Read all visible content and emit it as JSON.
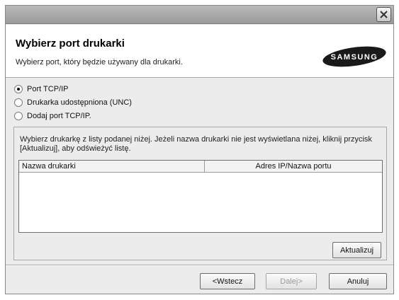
{
  "window": {
    "close_icon": "close-icon"
  },
  "header": {
    "title": "Wybierz port drukarki",
    "subtitle": "Wybierz port, który będzie używany dla drukarki.",
    "logo_text": "SAMSUNG"
  },
  "options": [
    {
      "label": "Port TCP/IP",
      "checked": true
    },
    {
      "label": "Drukarka udostępniona (UNC)",
      "checked": false
    },
    {
      "label": "Dodaj port TCP/IP.",
      "checked": false
    }
  ],
  "printer_group": {
    "description": "Wybierz drukarkę z listy podanej niżej. Jeżeli nazwa drukarki nie jest wyświetlana niżej, kliknij przycisk [Aktualizuj], aby odświeżyć listę.",
    "columns": [
      "Nazwa drukarki",
      "Adres IP/Nazwa portu"
    ],
    "rows": [],
    "refresh_label": "Aktualizuj"
  },
  "footer": {
    "back_label": "<Wstecz",
    "next_label": "Dalej>",
    "cancel_label": "Anuluj"
  }
}
